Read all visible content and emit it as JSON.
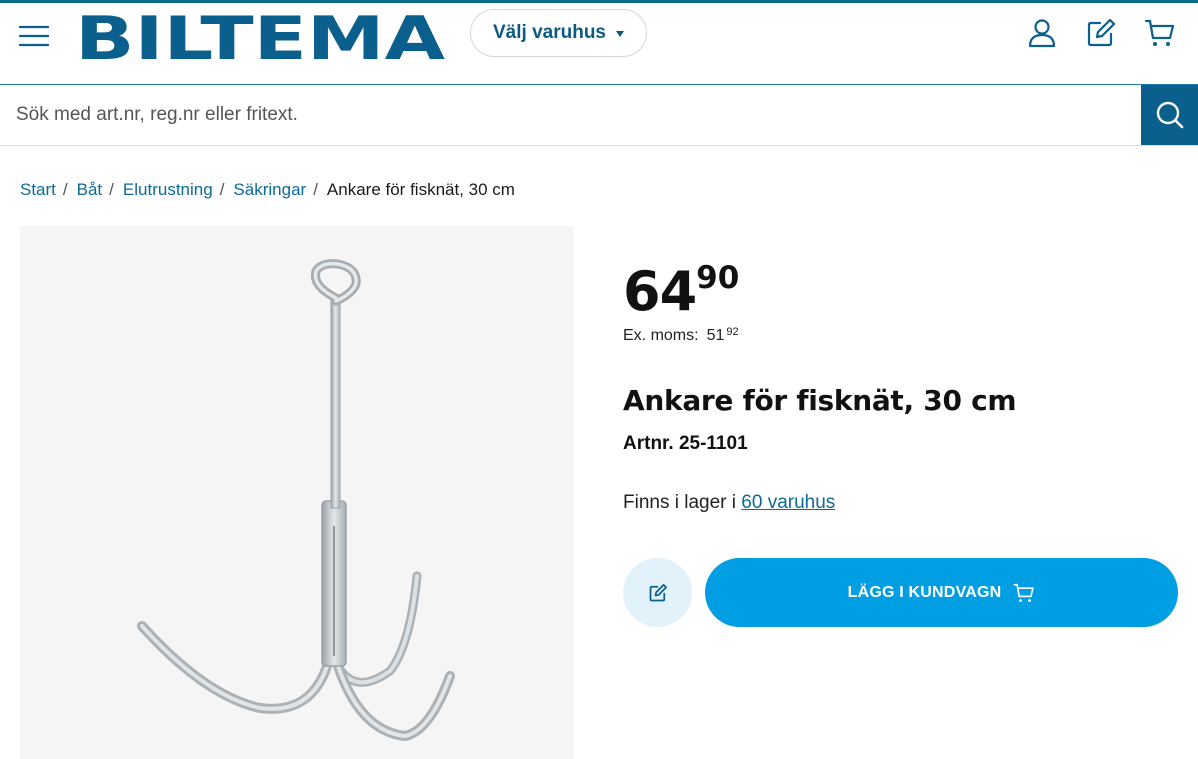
{
  "header": {
    "logo_text": "BILTEMA",
    "store_selector_label": "Välj varuhus"
  },
  "search": {
    "placeholder": "Sök med art.nr, reg.nr eller fritext."
  },
  "breadcrumb": {
    "items": [
      "Start",
      "Båt",
      "Elutrustning",
      "Säkringar"
    ],
    "current": "Ankare för fisknät, 30 cm"
  },
  "product": {
    "price_integer": "64",
    "price_decimals": "90",
    "vat_label": "Ex. moms:",
    "vat_integer": "51",
    "vat_decimals": "92",
    "title": "Ankare för fisknät, 30 cm",
    "artnr": "Artnr. 25-1101",
    "stock_text": "Finns i lager i",
    "stock_link": "60 varuhus",
    "add_to_cart_label": "LÄGG I KUNDVAGN"
  },
  "colors": {
    "brand_blue": "#0b5f8c",
    "cta_blue": "#009fe3",
    "link_blue": "#0c6a99"
  },
  "icons": [
    "menu-icon",
    "user-icon",
    "edit-icon",
    "cart-icon",
    "search-icon"
  ]
}
